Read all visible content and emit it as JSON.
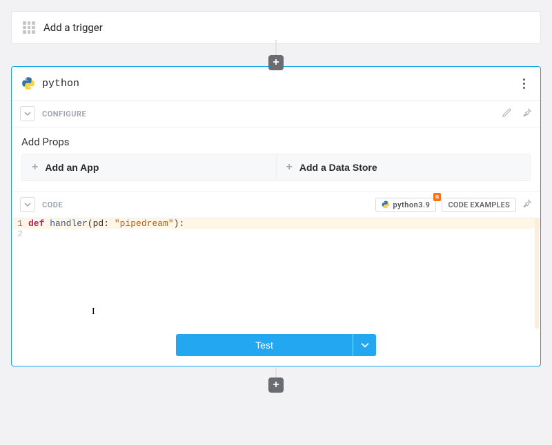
{
  "trigger": {
    "label": "Add a trigger"
  },
  "step": {
    "title": "python",
    "configure_label": "CONFIGURE",
    "add_props_label": "Add Props",
    "prop_buttons": {
      "app": "Add an App",
      "datastore": "Add a Data Store"
    },
    "code_label": "CODE",
    "runtime_chip": "python3.9",
    "alpha_badge": "α",
    "examples_chip": "CODE EXAMPLES",
    "code": {
      "line1": {
        "kw": "def ",
        "fn": "handler",
        "rest1": "(pd: ",
        "str": "\"pipedream\"",
        "rest2": "):"
      }
    },
    "test_label": "Test"
  },
  "icons": {
    "grid": "grid-icon",
    "plus": "+",
    "chevron_down": "chevron-down-icon",
    "pencil": "pencil-icon",
    "pin": "pin-icon",
    "kebab": "kebab-icon"
  }
}
